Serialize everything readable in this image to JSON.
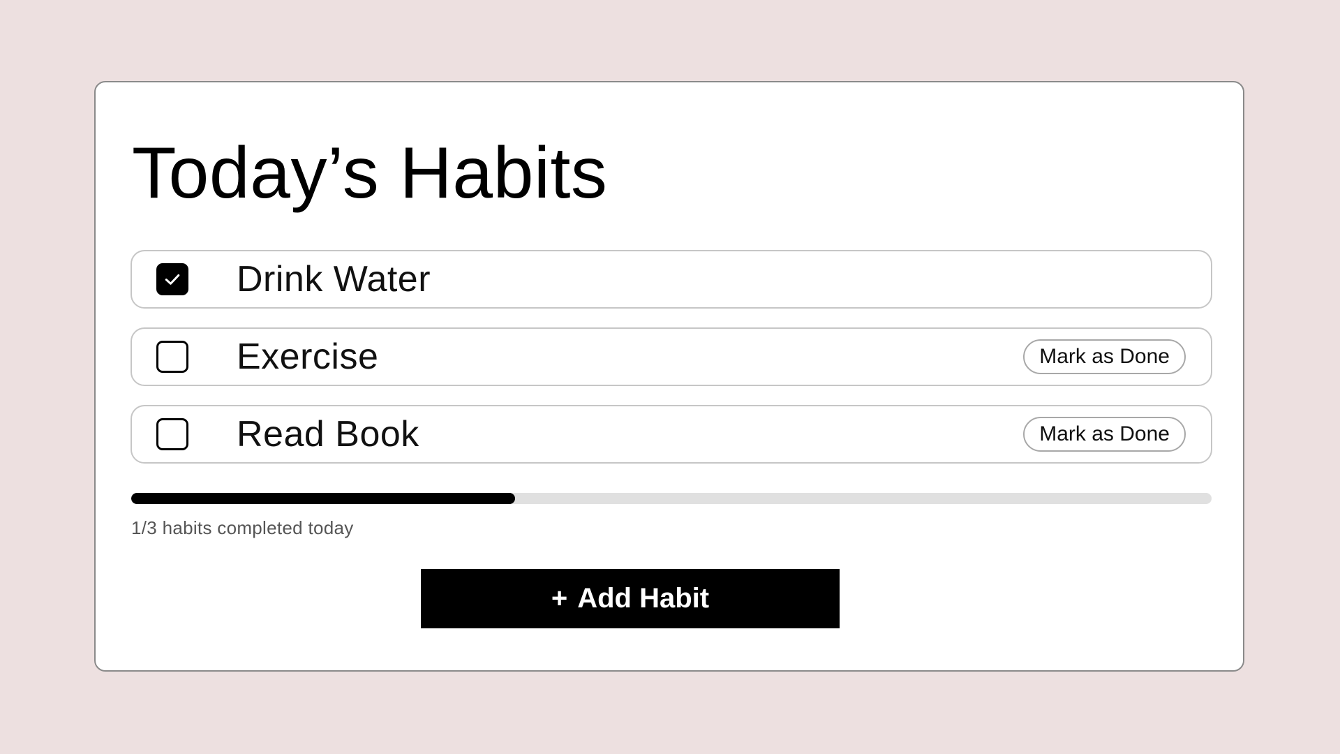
{
  "header": {
    "title": "Today’s Habits"
  },
  "habits": [
    {
      "label": "Drink Water",
      "done": true,
      "action_label": ""
    },
    {
      "label": "Exercise",
      "done": false,
      "action_label": "Mark as Done"
    },
    {
      "label": "Read Book",
      "done": false,
      "action_label": "Mark as Done"
    }
  ],
  "progress": {
    "completed": 1,
    "total": 3,
    "text": "1/3 habits completed today"
  },
  "add_button": {
    "icon": "+",
    "label": "Add Habit"
  },
  "colors": {
    "background": "#ede0e0",
    "card": "#ffffff",
    "accent": "#000000",
    "track": "#e0e0e0"
  }
}
